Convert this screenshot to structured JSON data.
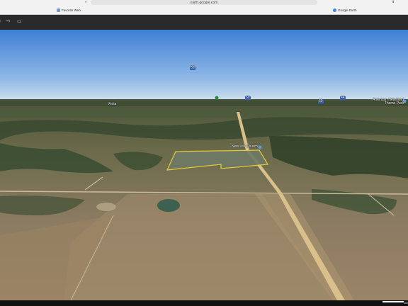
{
  "browser": {
    "url": "earth.google.com",
    "tabs": [
      {
        "label": "Favorite Web",
        "icon": "bookmark-icon"
      },
      {
        "label": "Google Earth",
        "icon": "google-earth-icon"
      }
    ]
  },
  "toolbar": {
    "icons": [
      "menu-icon",
      "path-icon",
      "layers-icon"
    ]
  },
  "map": {
    "labels": [
      {
        "text": "Vinita"
      },
      {
        "text": "American Heartland Theme Park"
      },
      {
        "text": "New Life Church"
      }
    ],
    "route_shields": [
      "66",
      "69",
      "60",
      "44"
    ]
  },
  "status": {
    "scale_label": "100"
  },
  "colors": {
    "sky_top": "#3f7fd4",
    "sky_horizon": "#c8dcec",
    "parcel_outline": "#f2d43a",
    "road": "#d9c08a",
    "chrome_bg": "#f2f2f2",
    "toolbar_bg": "#2a2a2d"
  }
}
